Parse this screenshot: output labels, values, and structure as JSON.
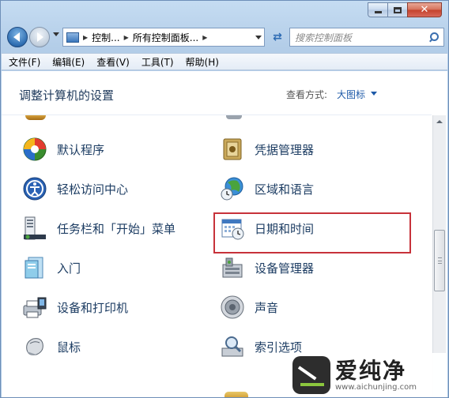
{
  "toolbar": {
    "breadcrumbs": [
      "控制...",
      "所有控制面板..."
    ],
    "search_placeholder": "搜索控制面板"
  },
  "menu": [
    "文件(F)",
    "编辑(E)",
    "查看(V)",
    "工具(T)",
    "帮助(H)"
  ],
  "header": {
    "title": "调整计算机的设置",
    "view_label": "查看方式:",
    "view_value": "大图标"
  },
  "items": [
    {
      "label": "默认程序",
      "icon": "default-programs-icon"
    },
    {
      "label": "凭据管理器",
      "icon": "credential-manager-icon"
    },
    {
      "label": "轻松访问中心",
      "icon": "ease-of-access-icon"
    },
    {
      "label": "区域和语言",
      "icon": "region-language-icon"
    },
    {
      "label": "任务栏和「开始」菜单",
      "icon": "taskbar-icon"
    },
    {
      "label": "日期和时间",
      "icon": "date-time-icon"
    },
    {
      "label": "入门",
      "icon": "getting-started-icon"
    },
    {
      "label": "设备管理器",
      "icon": "device-manager-icon"
    },
    {
      "label": "设备和打印机",
      "icon": "devices-printers-icon"
    },
    {
      "label": "声音",
      "icon": "sound-icon"
    },
    {
      "label": "鼠标",
      "icon": "mouse-icon"
    },
    {
      "label": "索引选项",
      "icon": "indexing-options-icon"
    }
  ],
  "watermark": {
    "main": "爱纯净",
    "url": "www.aichunjing.com"
  }
}
